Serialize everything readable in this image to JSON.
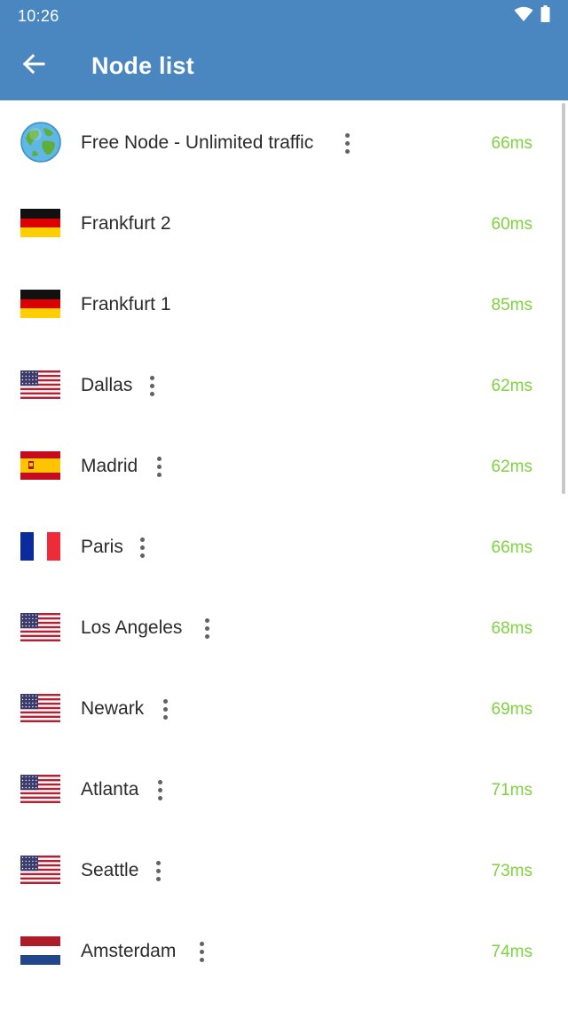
{
  "status_bar": {
    "time": "10:26",
    "icons": [
      "wifi-icon",
      "battery-icon"
    ]
  },
  "toolbar": {
    "back_icon": "arrow-left-icon",
    "title": "Node list",
    "color": "#4a86c0"
  },
  "latency_color": "#7ed23f",
  "nodes": [
    {
      "name": "Free Node - Unlimited traffic",
      "latency": "66ms",
      "flag": "globe",
      "has_menu": true
    },
    {
      "name": "Frankfurt 2",
      "latency": "60ms",
      "flag": "de",
      "has_menu": false
    },
    {
      "name": "Frankfurt 1",
      "latency": "85ms",
      "flag": "de",
      "has_menu": false
    },
    {
      "name": "Dallas",
      "latency": "62ms",
      "flag": "us",
      "has_menu": true
    },
    {
      "name": "Madrid",
      "latency": "62ms",
      "flag": "es",
      "has_menu": true
    },
    {
      "name": "Paris",
      "latency": "66ms",
      "flag": "fr",
      "has_menu": true
    },
    {
      "name": "Los Angeles",
      "latency": "68ms",
      "flag": "us",
      "has_menu": true
    },
    {
      "name": "Newark",
      "latency": "69ms",
      "flag": "us",
      "has_menu": true
    },
    {
      "name": "Atlanta",
      "latency": "71ms",
      "flag": "us",
      "has_menu": true
    },
    {
      "name": "Seattle",
      "latency": "73ms",
      "flag": "us",
      "has_menu": true
    },
    {
      "name": "Amsterdam",
      "latency": "74ms",
      "flag": "nl",
      "has_menu": true
    }
  ]
}
